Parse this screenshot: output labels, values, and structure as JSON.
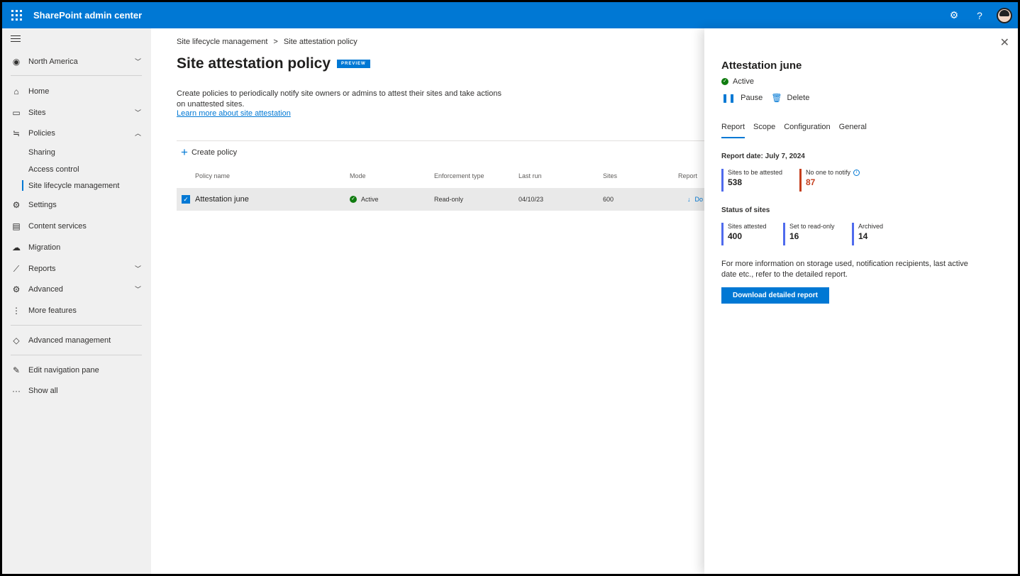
{
  "app": {
    "title": "SharePoint admin center"
  },
  "nav": {
    "region": "North America",
    "items": [
      {
        "label": "Home"
      },
      {
        "label": "Sites"
      },
      {
        "label": "Policies"
      },
      {
        "label": "Settings"
      },
      {
        "label": "Content services"
      },
      {
        "label": "Migration"
      },
      {
        "label": "Reports"
      },
      {
        "label": "Advanced"
      },
      {
        "label": "More features"
      },
      {
        "label": "Advanced management"
      },
      {
        "label": "Edit navigation pane"
      },
      {
        "label": "Show all"
      }
    ],
    "policy_subitems": [
      {
        "label": "Sharing"
      },
      {
        "label": "Access control"
      },
      {
        "label": "Site lifecycle management"
      }
    ]
  },
  "main": {
    "breadcrumb": [
      "Site lifecycle management",
      ">",
      "Site attestation policy"
    ],
    "title": "Site attestation policy",
    "badge": "PREVIEW",
    "description": "Create policies to periodically notify site owners or admins to attest their sites and take actions on unattested sites.",
    "learn_more": "Learn more about site attestation",
    "create_policy": "Create policy",
    "columns": [
      "Policy name",
      "Mode",
      "Enforcement type",
      "Last run",
      "Sites",
      "Report"
    ],
    "rows": [
      {
        "name": "Attestation june",
        "mode": "Active",
        "enforcement": "Read-only",
        "last_run": "04/10/23",
        "sites": "600",
        "report": "Do"
      }
    ]
  },
  "panel": {
    "title": "Attestation june",
    "status": "Active",
    "actions": {
      "pause": "Pause",
      "delete": "Delete"
    },
    "tabs": [
      "Report",
      "Scope",
      "Configuration",
      "General"
    ],
    "report_date": "Report date: July 7, 2024",
    "summary": [
      {
        "label": "Sites to be attested",
        "value": "538"
      },
      {
        "label": "No one to notify",
        "value": "87"
      }
    ],
    "status_heading": "Status of sites",
    "status_stats": [
      {
        "label": "Sites attested",
        "value": "400"
      },
      {
        "label": "Set to read-only",
        "value": "16"
      },
      {
        "label": "Archived",
        "value": "14"
      }
    ],
    "more_info": "For more information on storage used, notification recipients, last active date etc., refer to the detailed report.",
    "download": "Download detailed report"
  },
  "colors": {
    "brand": "#0078d4",
    "success": "#107c10",
    "warning": "#c43e1c",
    "stat_bar": "#4f6bed"
  }
}
